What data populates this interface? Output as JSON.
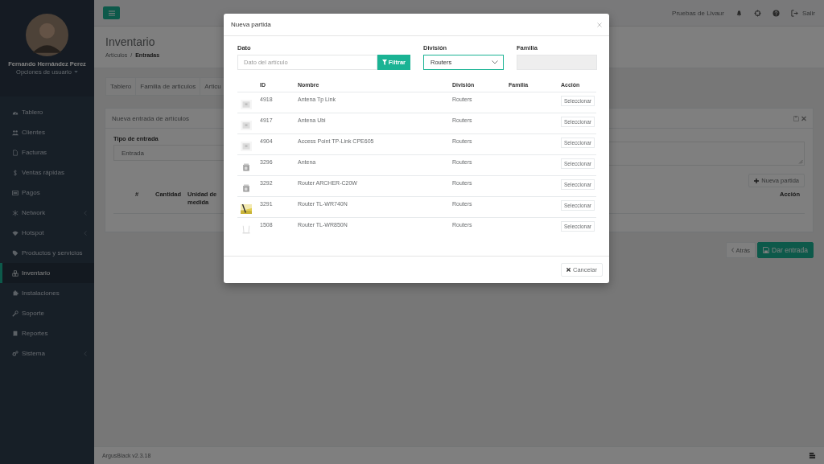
{
  "sidebar": {
    "user": {
      "name": "Fernando Hernández Perez",
      "options": "Opciones de usuario"
    },
    "items": [
      {
        "label": "Tablero",
        "kind": "gauge",
        "expandable": false,
        "selected": false
      },
      {
        "label": "Clientes",
        "kind": "users",
        "expandable": false,
        "selected": false
      },
      {
        "label": "Facturas",
        "kind": "file",
        "expandable": false,
        "selected": false
      },
      {
        "label": "Ventas rápidas",
        "kind": "dollar",
        "expandable": false,
        "selected": false
      },
      {
        "label": "Pagos",
        "kind": "card",
        "expandable": false,
        "selected": false
      },
      {
        "label": "Network",
        "kind": "network",
        "expandable": true,
        "selected": false
      },
      {
        "label": "Hotspot",
        "kind": "wifi",
        "expandable": true,
        "selected": false
      },
      {
        "label": "Productos y servicios",
        "kind": "tags",
        "expandable": false,
        "selected": false
      },
      {
        "label": "Inventario",
        "kind": "cubes",
        "expandable": false,
        "selected": true
      },
      {
        "label": "Instalaciones",
        "kind": "puzzle",
        "expandable": false,
        "selected": false
      },
      {
        "label": "Soporte",
        "kind": "wrench",
        "expandable": false,
        "selected": false
      },
      {
        "label": "Reportes",
        "kind": "book",
        "expandable": false,
        "selected": false
      },
      {
        "label": "Sistema",
        "kind": "cogs",
        "expandable": true,
        "selected": false
      }
    ]
  },
  "topbar": {
    "account": "Pruebas de Livaur",
    "logout": "Salir"
  },
  "header": {
    "title": "Inventario",
    "breadcrumb": {
      "parent": "Artículos",
      "separator": "/",
      "current": "Entradas"
    }
  },
  "tabs": [
    {
      "label": "Tablero"
    },
    {
      "label": "Familia de articulos"
    },
    {
      "label": "Articu"
    }
  ],
  "panel": {
    "title": "Nueva entrada de artículos",
    "type_label": "Tipo de entrada",
    "type_value": "Entrada",
    "add_button": "Nueva partida",
    "columns": [
      "#",
      "Cantidad",
      "Unidad de medida"
    ],
    "action_column": "Acción"
  },
  "actions": {
    "back": "Atrás",
    "submit": "Dar entrada"
  },
  "footer": {
    "version": "ArgusBlack v2.3.18"
  },
  "modal": {
    "title": "Nueva partida",
    "filters": {
      "data_label": "Dato",
      "data_placeholder": "Dato del artículo",
      "filter_button": "Filtrar",
      "division_label": "División",
      "division_value": "Routers",
      "family_label": "Familia"
    },
    "columns": [
      "ID",
      "Nombre",
      "División",
      "Familia",
      "Acción"
    ],
    "rows": [
      {
        "id": "4918",
        "name": "Antena Tp Link",
        "division": "Routers",
        "action": "Seleccionar"
      },
      {
        "id": "4917",
        "name": "Antena Ubi",
        "division": "Routers",
        "action": "Seleccionar"
      },
      {
        "id": "4904",
        "name": "Access Point TP-Link CPE605",
        "division": "Routers",
        "action": "Seleccionar"
      },
      {
        "id": "3296",
        "name": "Antena",
        "division": "Routers",
        "action": "Seleccionar"
      },
      {
        "id": "3292",
        "name": "Router ARCHER-C20W",
        "division": "Routers",
        "action": "Seleccionar"
      },
      {
        "id": "3291",
        "name": "Router TL-WR740N",
        "division": "Routers",
        "action": "Seleccionar"
      },
      {
        "id": "1508",
        "name": "Router TL-WR850N",
        "division": "Routers",
        "action": "Seleccionar"
      }
    ],
    "cancel": "Cancelar"
  }
}
